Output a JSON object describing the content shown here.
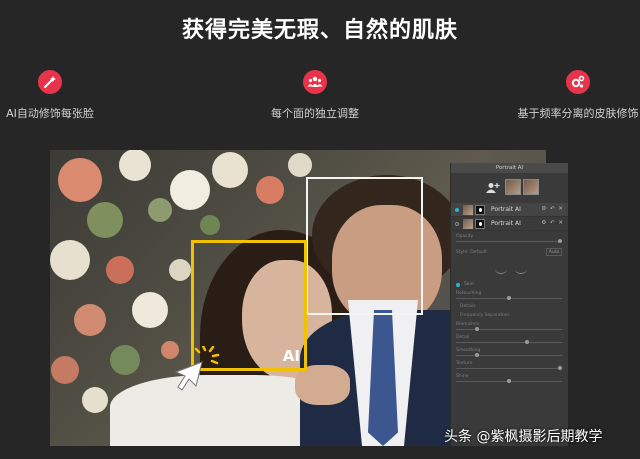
{
  "headline": "获得完美无瑕、自然的肌肤",
  "features": [
    {
      "label": "AI自动修饰每张脸",
      "icon": "magic-wand-icon"
    },
    {
      "label": "每个面的独立调整",
      "icon": "people-group-icon"
    },
    {
      "label": "基于频率分离的皮肤修饰",
      "icon": "gears-icon"
    }
  ],
  "colors": {
    "accent_red": "#e8344b",
    "highlight_yellow": "#f2c100",
    "panel_bg": "#3a3a3a",
    "page_bg": "#262626"
  },
  "photo": {
    "ai_badge": "AI"
  },
  "panel": {
    "title": "Portrait AI",
    "layers": [
      {
        "name": "Portrait AI",
        "controls": "⚙ ↶ ✕"
      },
      {
        "name": "Portrait AI",
        "controls": "⚙ ↶ ✕"
      }
    ],
    "opacity_label": "Opacity",
    "style_label": "Style: Default",
    "auto_label": "Auto",
    "skin_label": "Skin",
    "params": [
      "Retouching",
      "Details",
      "Frequency Separation",
      "Blemishes",
      "Detail",
      "Smoothing",
      "Texture",
      "Shine"
    ]
  },
  "watermark": "头条 @紫枫摄影后期教学"
}
